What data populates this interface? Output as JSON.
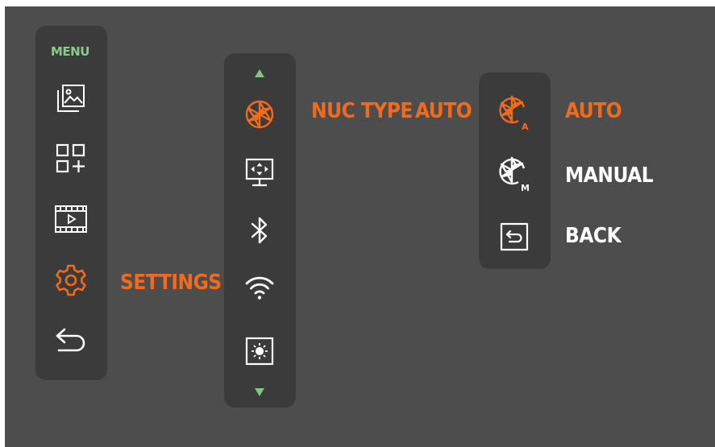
{
  "colors": {
    "accent": "#f26b1d",
    "menu_title": "#8dc98d",
    "arrow": "#7ccb7c",
    "icon_white": "#ffffff",
    "panel": "#3a3b3a",
    "background": "#4d4d4d"
  },
  "main_menu": {
    "title": "MENU",
    "items": [
      {
        "icon": "image-gallery-icon",
        "selected": false
      },
      {
        "icon": "add-widget-icon",
        "selected": false
      },
      {
        "icon": "video-playback-icon",
        "selected": false
      },
      {
        "icon": "gear-icon",
        "selected": true,
        "label": "SETTINGS"
      },
      {
        "icon": "back-arrow-icon",
        "selected": false
      }
    ]
  },
  "settings_menu": {
    "scroll_up_icon": "triangle-up-icon",
    "scroll_down_icon": "triangle-down-icon",
    "items": [
      {
        "icon": "aperture-icon",
        "selected": true,
        "label": "NUC TYPE",
        "value": "AUTO"
      },
      {
        "icon": "display-icon",
        "selected": false
      },
      {
        "icon": "bluetooth-icon",
        "selected": false
      },
      {
        "icon": "wifi-icon",
        "selected": false
      },
      {
        "icon": "brightness-icon",
        "selected": false
      }
    ]
  },
  "nuc_menu": {
    "options": [
      {
        "icon": "aperture-auto-icon",
        "label": "AUTO",
        "selected": true
      },
      {
        "icon": "aperture-manual-icon",
        "label": "MANUAL",
        "selected": false
      },
      {
        "icon": "back-box-icon",
        "label": "BACK",
        "selected": false
      }
    ]
  }
}
